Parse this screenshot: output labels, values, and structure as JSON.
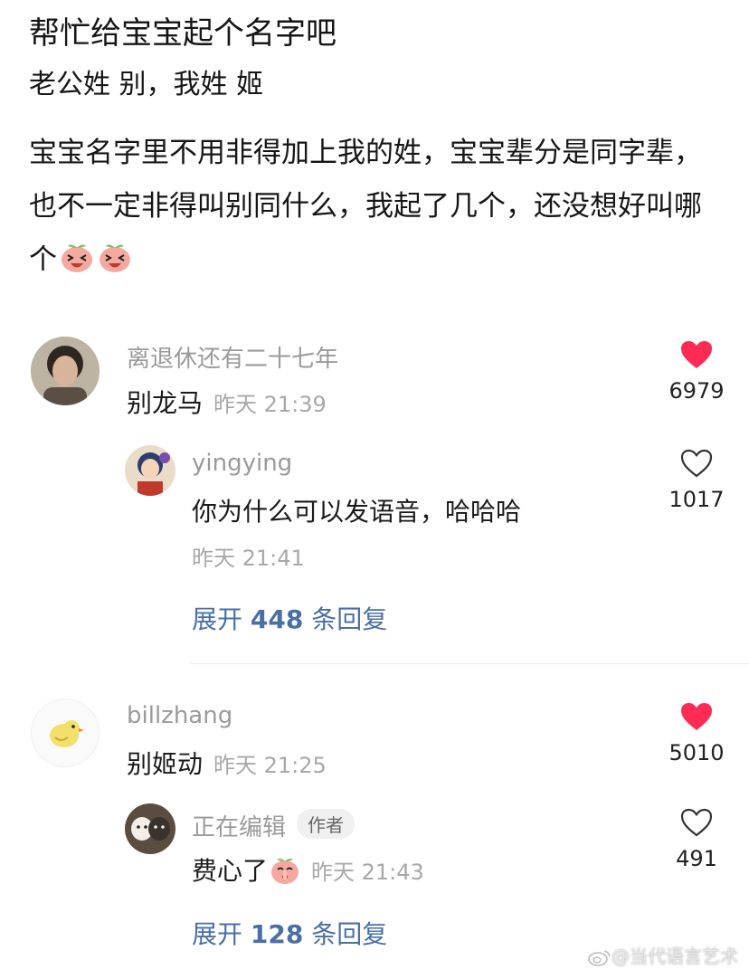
{
  "post": {
    "title": "帮忙给宝宝起个名字吧",
    "subtitle": "老公姓  别，我姓  姬",
    "body": "宝宝名字里不用非得加上我的姓，宝宝辈分是同字辈，也不一定非得叫别同什么，我起了几个，还没想好叫哪个"
  },
  "comments": [
    {
      "user": "离退休还有二十七年",
      "text": "别龙马",
      "time": "昨天 21:39",
      "likes": "6979",
      "liked": true,
      "replies": [
        {
          "user": "yingying",
          "text": "你为什么可以发语音，哈哈哈",
          "time": "昨天 21:41",
          "likes": "1017",
          "liked": false
        }
      ],
      "expand": {
        "prefix": "展开",
        "count": "448",
        "suffix": "条回复"
      }
    },
    {
      "user": "billzhang",
      "text": "别姬动",
      "time": "昨天 21:25",
      "likes": "5010",
      "liked": true,
      "replies": [
        {
          "user": "正在编辑",
          "tag": "作者",
          "text": "费心了",
          "time": "昨天 21:43",
          "likes": "491",
          "liked": false
        }
      ],
      "expand": {
        "prefix": "展开",
        "count": "128",
        "suffix": "条回复"
      }
    }
  ],
  "watermark": "@当代语言艺术",
  "colors": {
    "like_active": "#fe2c55",
    "link": "#4a6fa5",
    "meta": "#a8a8a8"
  },
  "icons": [
    "heart-filled-icon",
    "heart-outline-icon",
    "laughing-peach-emoji-icon",
    "shy-peach-emoji-icon",
    "weibo-logo-icon"
  ]
}
